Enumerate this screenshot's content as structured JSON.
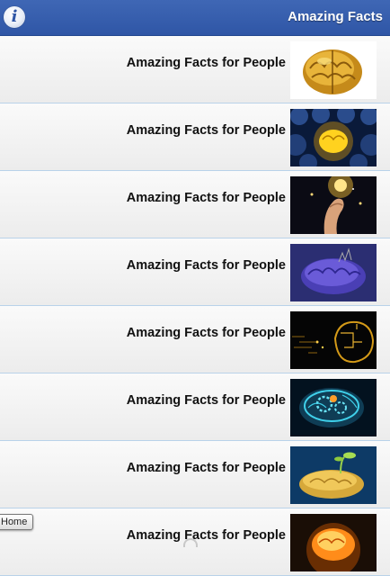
{
  "header": {
    "title": "Amazing Facts",
    "info_icon": "info-icon"
  },
  "items": [
    {
      "label": "Amazing Facts for People",
      "thumb": "golden-brain"
    },
    {
      "label": "Amazing Facts for People",
      "thumb": "glowing-brain-crowd"
    },
    {
      "label": "Amazing Facts for People",
      "thumb": "hand-lightbulb"
    },
    {
      "label": "Amazing Facts for People",
      "thumb": "purple-brain"
    },
    {
      "label": "Amazing Facts for People",
      "thumb": "circuit-brain"
    },
    {
      "label": "Amazing Facts for People",
      "thumb": "gear-brain"
    },
    {
      "label": "Amazing Facts for People",
      "thumb": "brain-sprout"
    },
    {
      "label": "Amazing Facts for People",
      "thumb": "fire-brain"
    }
  ],
  "home_button": {
    "label": "Home"
  },
  "colors": {
    "header": "#2f56a6",
    "divider": "#b9d2e9"
  }
}
